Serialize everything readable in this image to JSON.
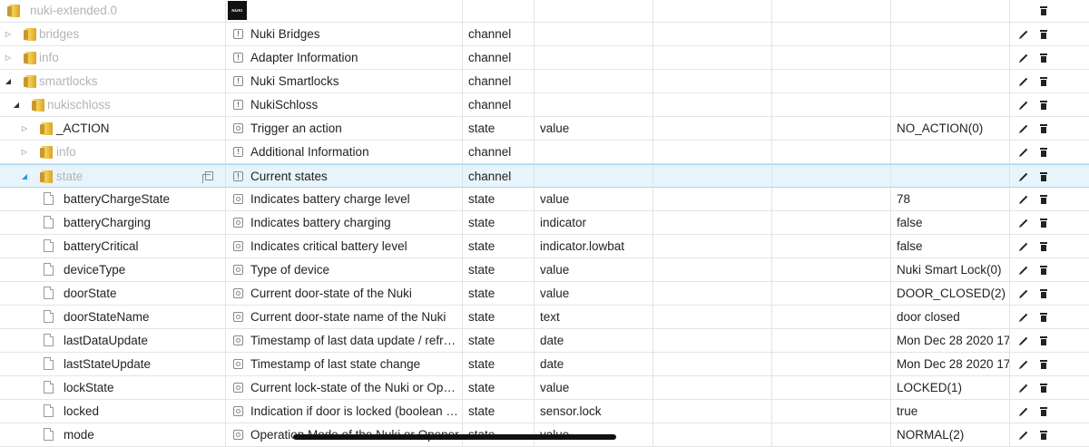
{
  "rows": [
    {
      "id": "nuki-extended.0",
      "level": 0,
      "node": "root",
      "toggle": "",
      "muted": true,
      "name": "",
      "logo": "NUKI",
      "type": "",
      "role": "",
      "value": "",
      "edit": false
    },
    {
      "id": "bridges",
      "level": 1,
      "node": "folder",
      "toggle": "closed",
      "muted": true,
      "name": "Nuki Bridges",
      "icon": "channel",
      "type": "channel",
      "role": "",
      "value": "",
      "edit": true
    },
    {
      "id": "info",
      "level": 1,
      "node": "folder",
      "toggle": "closed",
      "muted": true,
      "name": "Adapter Information",
      "icon": "channel",
      "type": "channel",
      "role": "",
      "value": "",
      "edit": true
    },
    {
      "id": "smartlocks",
      "level": 1,
      "node": "folder",
      "toggle": "open",
      "muted": true,
      "name": "Nuki Smartlocks",
      "icon": "channel",
      "type": "channel",
      "role": "",
      "value": "",
      "edit": true
    },
    {
      "id": "nukischloss",
      "level": 2,
      "node": "folder",
      "toggle": "open",
      "muted": true,
      "name": "NukiSchloss",
      "icon": "channel",
      "type": "channel",
      "role": "",
      "value": "",
      "edit": true
    },
    {
      "id": "_ACTION",
      "level": 3,
      "node": "folder",
      "toggle": "closed",
      "muted": false,
      "name": "Trigger an action",
      "icon": "state",
      "type": "state",
      "role": "value",
      "value": "NO_ACTION(0)",
      "edit": true
    },
    {
      "id": "info",
      "level": 3,
      "node": "folder",
      "toggle": "closed",
      "muted": true,
      "name": "Additional Information",
      "icon": "channel",
      "type": "channel",
      "role": "",
      "value": "",
      "edit": true
    },
    {
      "id": "state",
      "level": 3,
      "node": "folder",
      "toggle": "sel",
      "muted": true,
      "selected": true,
      "name": "Current states",
      "icon": "channel",
      "type": "channel",
      "role": "",
      "value": "",
      "edit": true
    },
    {
      "id": "batteryChargeState",
      "level": 4,
      "node": "file",
      "muted": false,
      "name": "Indicates battery charge level",
      "icon": "state",
      "type": "state",
      "role": "value",
      "value": "78",
      "edit": true
    },
    {
      "id": "batteryCharging",
      "level": 4,
      "node": "file",
      "muted": false,
      "name": "Indicates battery charging",
      "icon": "state",
      "type": "state",
      "role": "indicator",
      "value": "false",
      "edit": true
    },
    {
      "id": "batteryCritical",
      "level": 4,
      "node": "file",
      "muted": false,
      "name": "Indicates critical battery level",
      "icon": "state",
      "type": "state",
      "role": "indicator.lowbat",
      "value": "false",
      "edit": true
    },
    {
      "id": "deviceType",
      "level": 4,
      "node": "file",
      "muted": false,
      "name": "Type of device",
      "icon": "state",
      "type": "state",
      "role": "value",
      "value": "Nuki Smart Lock(0)",
      "edit": true
    },
    {
      "id": "doorState",
      "level": 4,
      "node": "file",
      "muted": false,
      "name": "Current door-state of the Nuki",
      "icon": "state",
      "type": "state",
      "role": "value",
      "value": "DOOR_CLOSED(2)",
      "edit": true
    },
    {
      "id": "doorStateName",
      "level": 4,
      "node": "file",
      "muted": false,
      "name": "Current door-state name of the Nuki",
      "icon": "state",
      "type": "state",
      "role": "text",
      "value": "door closed",
      "edit": true
    },
    {
      "id": "lastDataUpdate",
      "level": 4,
      "node": "file",
      "muted": false,
      "name": "Timestamp of last data update / refr…",
      "icon": "state",
      "type": "state",
      "role": "date",
      "value": "Mon Dec 28 2020 17",
      "edit": true
    },
    {
      "id": "lastStateUpdate",
      "level": 4,
      "node": "file",
      "muted": false,
      "name": "Timestamp of last state change",
      "icon": "state",
      "type": "state",
      "role": "date",
      "value": "Mon Dec 28 2020 17",
      "edit": true
    },
    {
      "id": "lockState",
      "level": 4,
      "node": "file",
      "muted": false,
      "name": "Current lock-state of the Nuki or Op…",
      "icon": "state",
      "type": "state",
      "role": "value",
      "value": "LOCKED(1)",
      "edit": true
    },
    {
      "id": "locked",
      "level": 4,
      "node": "file",
      "muted": false,
      "name": "Indication if door is locked (boolean …",
      "icon": "state",
      "type": "state",
      "role": "sensor.lock",
      "value": "true",
      "edit": true
    },
    {
      "id": "mode",
      "level": 4,
      "node": "file",
      "muted": false,
      "name": "Operation Mode of the Nuki or Opener",
      "icon": "state",
      "type": "state",
      "role": "value",
      "value": "NORMAL(2)",
      "edit": true
    }
  ],
  "icons": {
    "edit": "pencil-icon",
    "delete": "trash-icon",
    "copy": "copy-icon",
    "folder": "folder-icon",
    "file": "file-icon"
  }
}
